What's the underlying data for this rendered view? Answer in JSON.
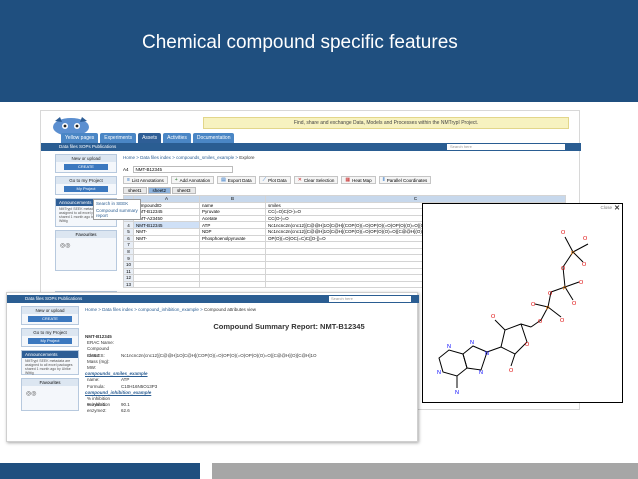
{
  "slide": {
    "title": "Chemical compound specific features"
  },
  "back_window": {
    "nav_tabs": [
      "Yellow pages",
      "Experiments",
      "Assets",
      "Activities",
      "Documentation"
    ],
    "active_tab": "Assets",
    "banner_text": "Find, share and exchange Data, Models and Processes within the NMTrypI Project.",
    "strip_links": "Data files   SOPs   Publications",
    "search_placeholder": "Search here",
    "sidebar": {
      "new_or_upload": "New or upload",
      "create": "CREATE",
      "go_to_project": "Go to my Project",
      "my_project": "My Project",
      "announcements": "Announcements",
      "announcement_text": "NMTrypI SEEK metadata are assigned to all excel packages shared 1 month ago by Ulrike Wittig",
      "favourites": "Favourites",
      "tags": "Tags (show all)",
      "tags_text": "computational structural biology"
    },
    "breadcrumb": {
      "a": "Home",
      "b": "Data files index",
      "c": "compounds_smiles_example",
      "d": "Explore"
    },
    "cell_ref": "A4",
    "cell_value": "NMT-B12345",
    "toolbar": [
      "List Annotations",
      "Add Annotation",
      "Export Data",
      "Plot Data",
      "Clear Selection",
      "Heat Map",
      "Parallel Coordinates"
    ],
    "sheet_tabs": [
      "sheet1",
      "sheet2",
      "sheet3"
    ],
    "grid": {
      "col_headers": [
        "",
        "A",
        "B",
        "C"
      ],
      "rows": [
        [
          "1",
          "compoundID",
          "name",
          "smiles"
        ],
        [
          "2",
          "NMT-B12345",
          "Pyruvate",
          "CC(=O)C(O-)=O"
        ],
        [
          "3",
          "NMT-A23450",
          "Acetate",
          "CC(O-)=O"
        ],
        [
          "4",
          "NMT-B12345",
          "ATP",
          "Nc1ncnc2n(cnc12)[C@@H]1O[C@H](COP(O)(=O)OP(O)(=O)OP(O)(O)=O)[C@@H](O)[C@H]1O"
        ],
        [
          "5",
          "NMT-",
          "NDP",
          "Nc1ncnc2n(cnc12)[C@@H]1O[C@H](COP(O)(=O)OP(O)(O)=O)[C@@H](O)[C@H]1O"
        ],
        [
          "6",
          "NMT-",
          "Phosphoenolpyruvate",
          "OP(O)(=O)OC(=C)C([O-])=O"
        ],
        [
          "7",
          "",
          "",
          ""
        ],
        [
          "8",
          "",
          "",
          ""
        ],
        [
          "9",
          "",
          "",
          ""
        ],
        [
          "10",
          "",
          "",
          ""
        ],
        [
          "11",
          "",
          "",
          ""
        ],
        [
          "12",
          "",
          "",
          ""
        ],
        [
          "13",
          "",
          "",
          ""
        ]
      ]
    },
    "context_menu": [
      "Search in SEEK",
      "Compound summary report"
    ]
  },
  "front_window": {
    "strip_links": "Data files   SOPs   Publications",
    "search_placeholder": "Search here",
    "breadcrumb": {
      "a": "Home",
      "b": "Data files index",
      "c": "compound_inhibition_example",
      "d": "Compound attributes view"
    },
    "report_title": "Compound Summary Report: NMT-B12345",
    "compound_id": "NMT-B12345",
    "fields": [
      {
        "label": "ERAC Name:",
        "value": ""
      },
      {
        "label": "Compound Class:",
        "value": ""
      },
      {
        "label": "SMILES:",
        "value": "Nc1ncnc2n(cnc12)[C@@H]1O[C@H](COP(O)(=O)OP(O)(=O)OP(O)(O)=O)[C@@H](O)[C@H]1O"
      },
      {
        "label": "Mass (mg):",
        "value": ""
      },
      {
        "label": "MW:",
        "value": ""
      }
    ],
    "smiles_section": "compounds_smiles_example",
    "smiles_fields": [
      {
        "label": "name:",
        "value": "ATP"
      },
      {
        "label": "Formula:",
        "value": "C10H16N5O13P3"
      }
    ],
    "inhibition_section": "compound_inhibition_example",
    "inhibition_fields": [
      {
        "label": "% inhibition enzyme1:",
        "value": "90.1"
      },
      {
        "label": "% inhibition enzyme2:",
        "value": "62.6"
      }
    ]
  },
  "structure_panel": {
    "close_label": "Close",
    "atoms": {
      "O": "O",
      "N": "N",
      "P": "P"
    }
  }
}
